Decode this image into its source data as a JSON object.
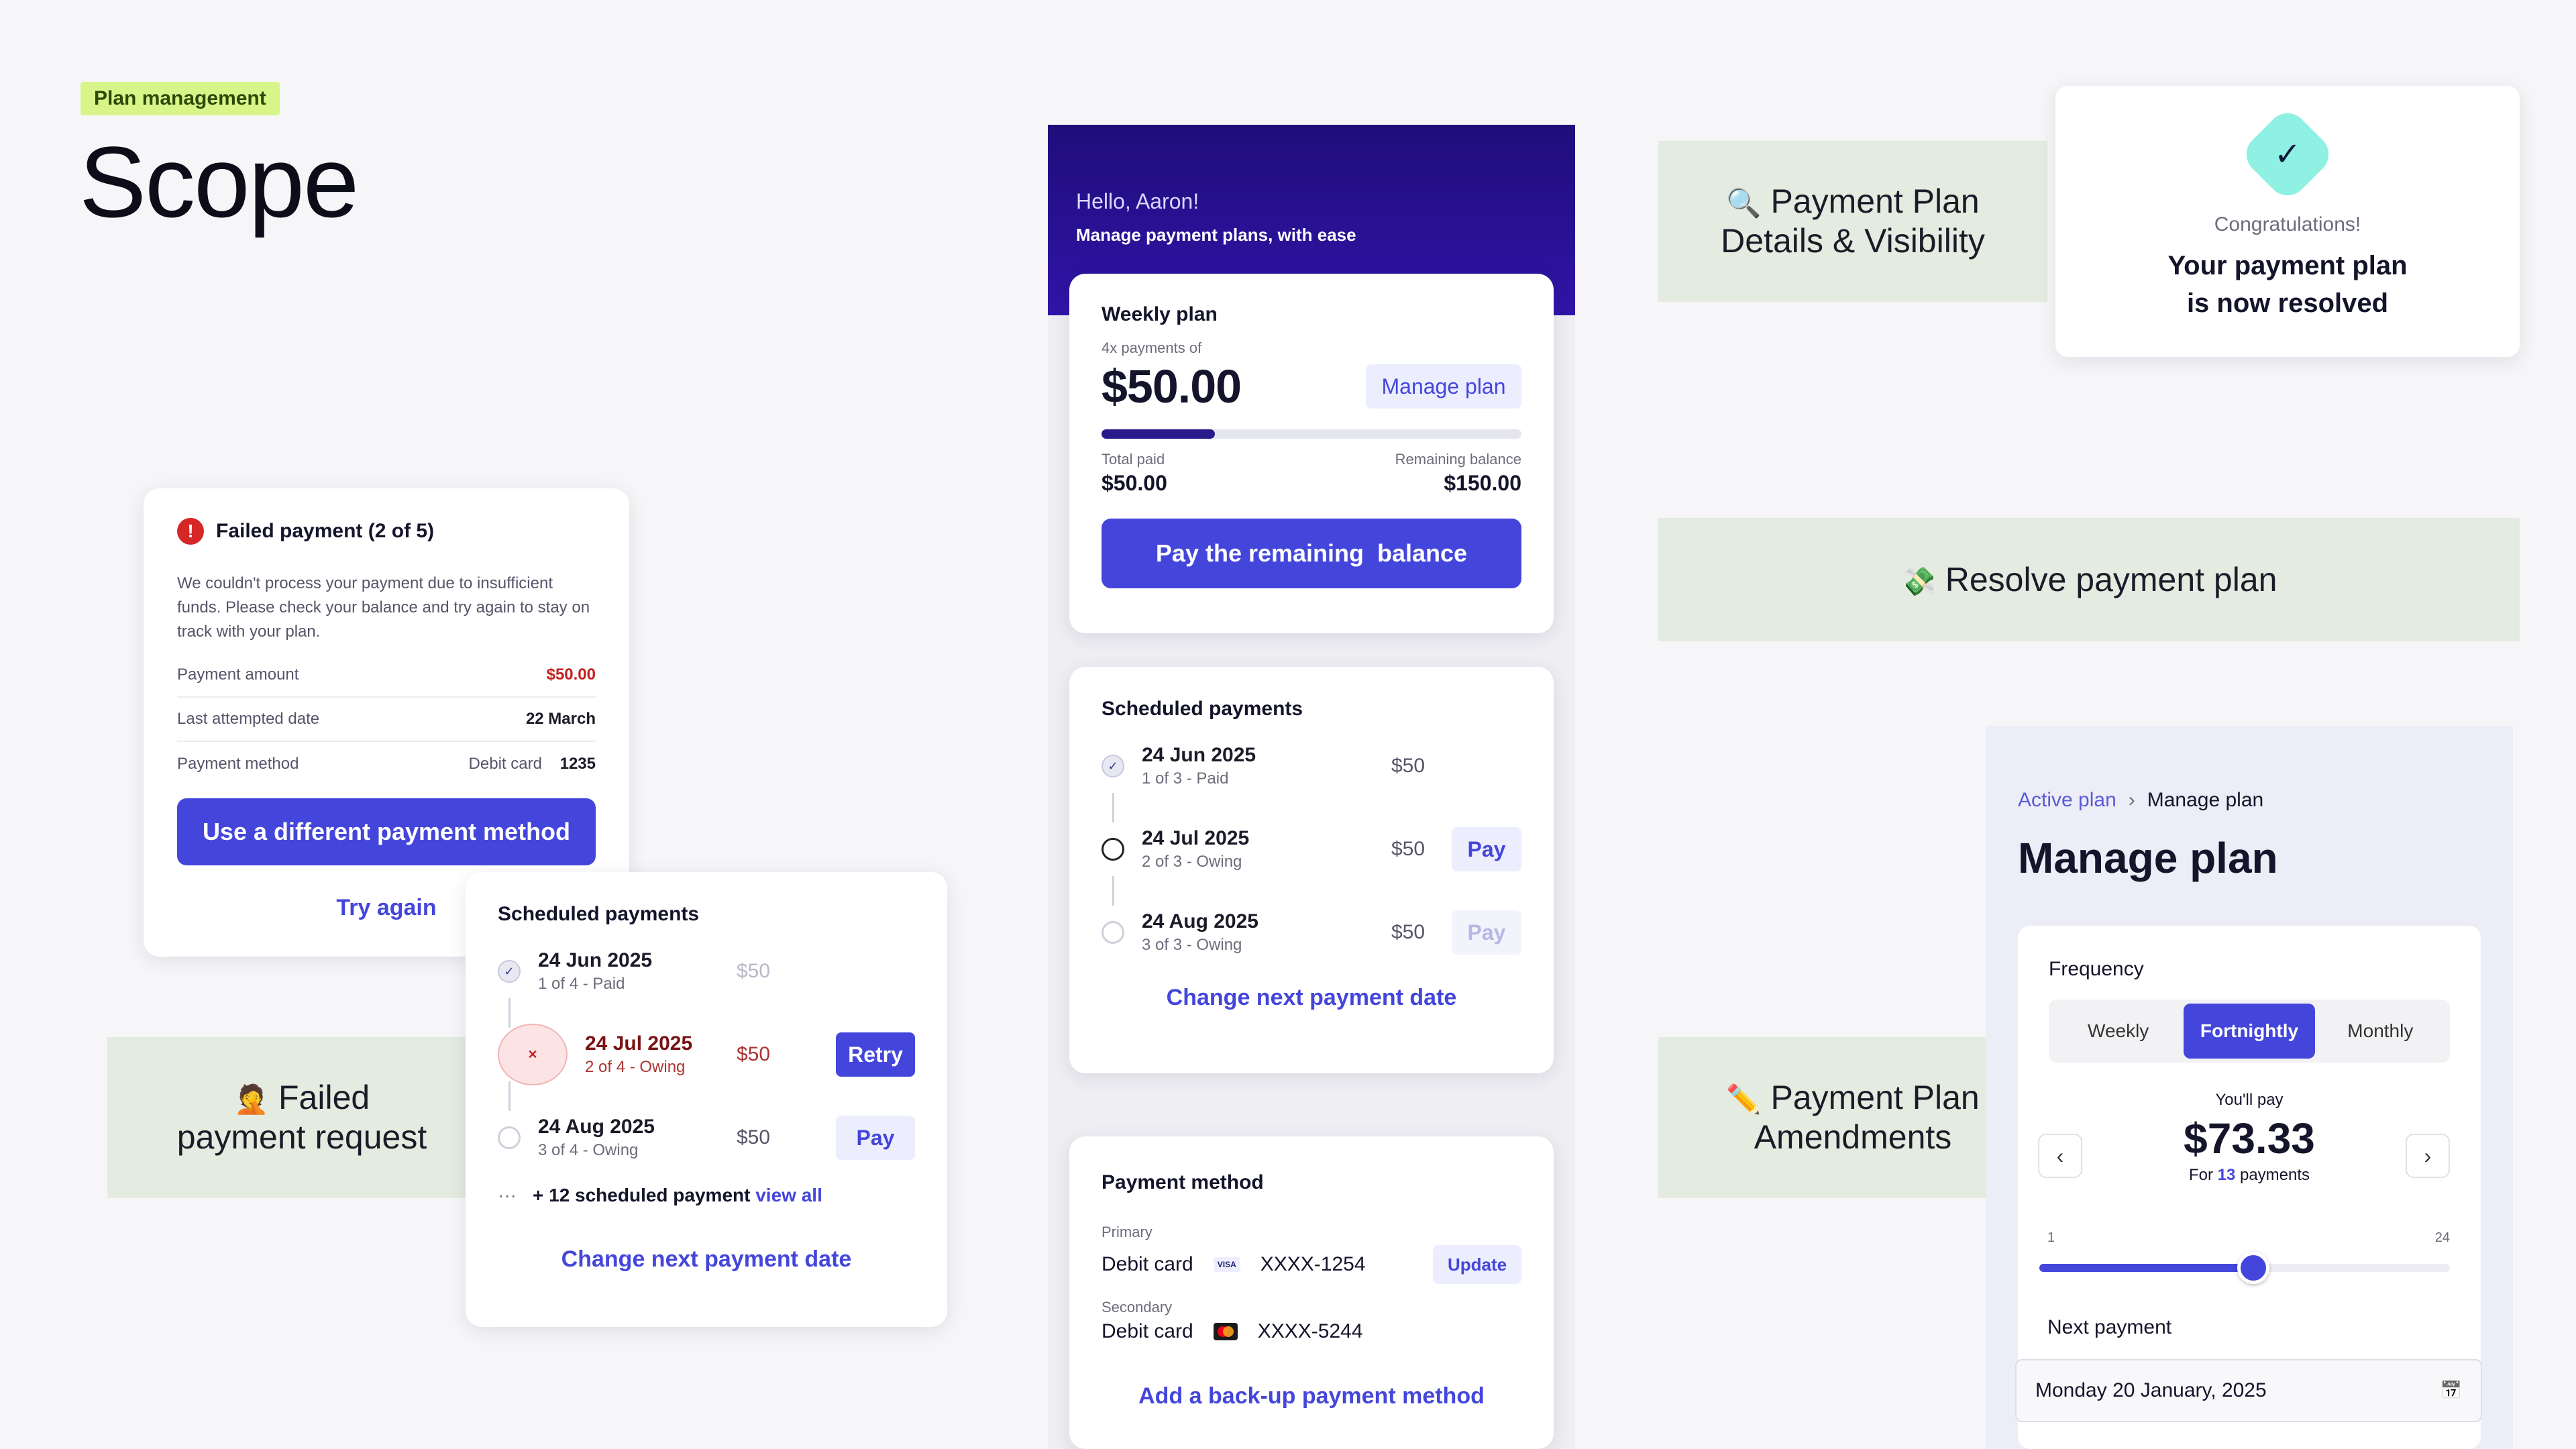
{
  "header": {
    "tag": "Plan management",
    "title": "Scope"
  },
  "labels": {
    "visibility": {
      "emoji": "🔍",
      "line1": "Payment Plan",
      "line2": "Details & Visibility"
    },
    "resolve": {
      "emoji": "💸",
      "text": "Resolve payment plan"
    },
    "failed": {
      "emoji": "🤦",
      "line1": "Failed",
      "line2": "payment request"
    },
    "amend": {
      "emoji": "✏️",
      "line1": "Payment Plan",
      "line2": "Amendments"
    }
  },
  "failed_card": {
    "error_icon": "!",
    "title": "Failed payment (2 of 5)",
    "description": "We couldn't process your payment due to insufficient funds. Please check your balance and try again to stay on track with your plan.",
    "rows": [
      {
        "label": "Payment amount",
        "value": "$50.00"
      },
      {
        "label": "Last attempted date",
        "value": "22 March"
      },
      {
        "label": "Payment method",
        "type": "Debit card",
        "value": "1235"
      }
    ],
    "primary_button": "Use a different payment method",
    "secondary_link": "Try again"
  },
  "sched_small": {
    "title": "Scheduled payments",
    "items": [
      {
        "date": "24 Jun 2025",
        "status": "1 of 4 - Paid",
        "amount": "$50"
      },
      {
        "date": "24 Jul 2025",
        "status": "2 of 4 - Owing",
        "amount": "$50",
        "action": "Retry"
      },
      {
        "date": "24 Aug 2025",
        "status": "3 of 4 - Owing",
        "amount": "$50",
        "action": "Pay"
      }
    ],
    "more_dots": "···",
    "more_text": "+ 12 scheduled payment",
    "view_all": "view all",
    "change_link": "Change next payment date"
  },
  "phone": {
    "greeting": "Hello, Aaron!",
    "tagline": "Manage payment plans, with ease",
    "weekly": {
      "title": "Weekly plan",
      "subtitle": "4x payments of",
      "amount": "$50.00",
      "manage_button": "Manage plan",
      "progress_fraction": 0.27,
      "total_paid_label": "Total paid",
      "total_paid": "$50.00",
      "remaining_label": "Remaining balance",
      "remaining": "$150.00",
      "pay_button": "Pay the remaining  balance"
    },
    "scheduled": {
      "title": "Scheduled payments",
      "items": [
        {
          "date": "24 Jun 2025",
          "status": "1 of 3 - Paid",
          "amount": "$50"
        },
        {
          "date": "24 Jul 2025",
          "status": "2 of 3 - Owing",
          "amount": "$50",
          "action": "Pay"
        },
        {
          "date": "24 Aug 2025",
          "status": "3 of 3 - Owing",
          "amount": "$50",
          "action": "Pay"
        }
      ],
      "change_link": "Change next payment date"
    },
    "payment_method": {
      "title": "Payment method",
      "primary_label": "Primary",
      "primary_type": "Debit card",
      "primary_brand": "VISA",
      "primary_number": "XXXX-1254",
      "update_button": "Update",
      "secondary_label": "Secondary",
      "secondary_type": "Debit card",
      "secondary_number": "XXXX-5244",
      "add_link": "Add a back-up payment method"
    }
  },
  "congrats": {
    "check": "✓",
    "small": "Congratulations!",
    "line1": "Your payment plan",
    "line2": "is now resolved"
  },
  "manage_plan": {
    "breadcrumb_parent": "Active plan",
    "breadcrumb_sep": "›",
    "breadcrumb_current": "Manage plan",
    "title": "Manage plan",
    "frequency_label": "Frequency",
    "options": [
      "Weekly",
      "Fortnightly",
      "Monthly"
    ],
    "selected": "Fortnightly",
    "youll_pay": "You'll pay",
    "amount": "$73.33",
    "for_prefix": "For",
    "count": "13",
    "for_suffix": "payments",
    "prev": "‹",
    "next": "›",
    "slider_min": "1",
    "slider_max": "24",
    "slider_value": 13,
    "next_payment_label": "Next payment",
    "next_payment_value": "Monday 20 January, 2025",
    "calendar_icon": "📅"
  },
  "colors": {
    "primary": "#4446db",
    "error": "#d62727",
    "label_bg": "#e4ebe0",
    "tag_bg": "#d8f58a"
  }
}
